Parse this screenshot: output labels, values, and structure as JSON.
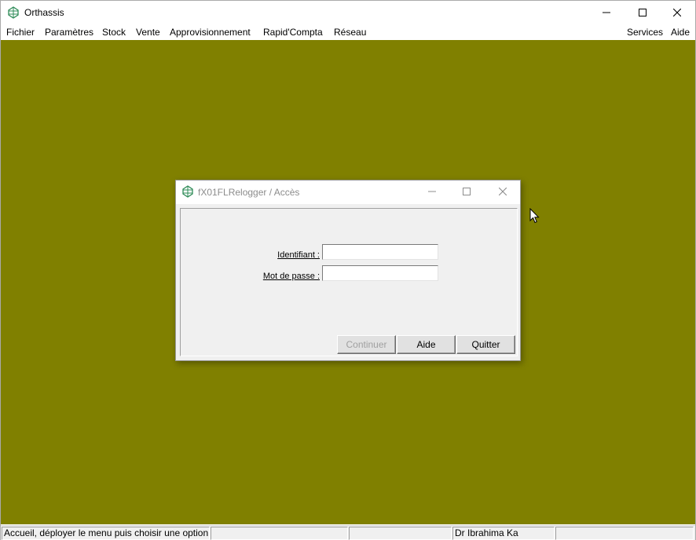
{
  "app": {
    "title": "Orthassis",
    "icon": "orthassis-logo-icon"
  },
  "window_controls": {
    "minimize": "minimize-icon",
    "maximize": "maximize-icon",
    "close": "close-icon"
  },
  "menubar": {
    "left": [
      "Fichier",
      "Paramètres",
      "Stock",
      "Vente",
      "Approvisionnement",
      "Rapid'Compta",
      "Réseau"
    ],
    "right": [
      "Services",
      "Aide"
    ]
  },
  "desktop": {
    "background_color": "#808000"
  },
  "dialog": {
    "title": "fX01FLRelogger / Accès",
    "fields": {
      "identifiant_label": "Identifiant :",
      "identifiant_value": "",
      "password_label": "Mot de passe :",
      "password_value": ""
    },
    "buttons": {
      "continuer": "Continuer",
      "aide": "Aide",
      "quitter": "Quitter"
    }
  },
  "statusbar": {
    "message": "Accueil, déployer le menu puis choisir une option.",
    "user": "Dr Ibrahima Ka"
  }
}
